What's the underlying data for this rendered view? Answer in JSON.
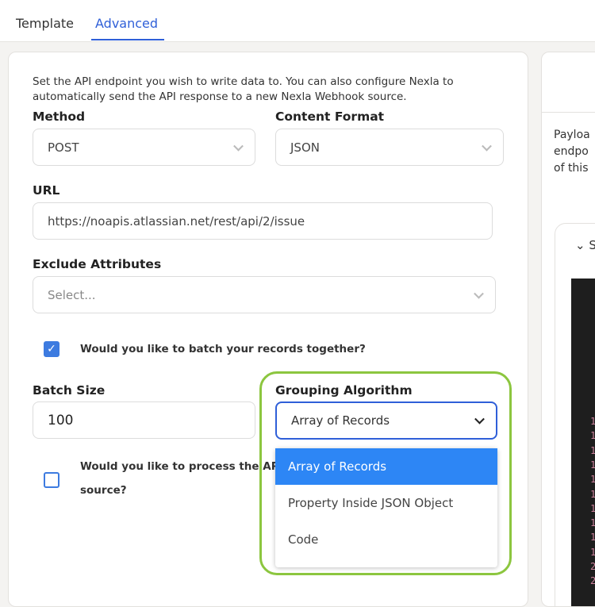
{
  "tabs": [
    {
      "label": "Template",
      "active": false
    },
    {
      "label": "Advanced",
      "active": true
    }
  ],
  "description": "Set the API endpoint you wish to write data to. You can also configure Nexla to automatically send the API response to a new Nexla Webhook source.",
  "method": {
    "label": "Method",
    "value": "POST"
  },
  "content_format": {
    "label": "Content Format",
    "value": "JSON"
  },
  "url": {
    "label": "URL",
    "value": "https://noapis.atlassian.net/rest/api/2/issue"
  },
  "exclude": {
    "label": "Exclude Attributes",
    "placeholder": "Select..."
  },
  "batch_checkbox": {
    "label": "Would you like to batch your records together?",
    "checked": true
  },
  "batch_size": {
    "label": "Batch Size",
    "value": "100"
  },
  "grouping": {
    "label": "Grouping Algorithm",
    "value": "Array of Records",
    "options": [
      "Array of Records",
      "Property Inside JSON Object",
      "Code"
    ]
  },
  "process_checkbox": {
    "label_line1": "Would you like to process the AP",
    "label_line2": "source?",
    "checked": false
  },
  "right_panel": {
    "desc_lines": [
      "Payloa",
      "endpo",
      "of this"
    ],
    "section": "S",
    "line_numbers": [
      "1",
      "1",
      "1",
      "1",
      "1",
      "1",
      "1",
      "1",
      "1",
      "1",
      "2",
      "2"
    ]
  },
  "colors": {
    "accent": "#2f5fd8",
    "selected_option": "#2d86f5",
    "highlight": "#8cc63f"
  }
}
